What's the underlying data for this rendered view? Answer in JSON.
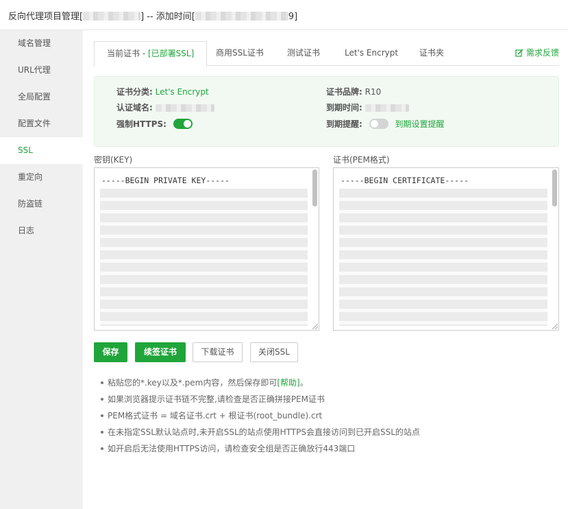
{
  "window": {
    "title_prefix": "反向代理项目管理[",
    "title_middle": "] -- 添加时间[",
    "title_suffix": "9]"
  },
  "sidebar": {
    "items": [
      {
        "label": "域名管理"
      },
      {
        "label": "URL代理"
      },
      {
        "label": "全局配置"
      },
      {
        "label": "配置文件"
      },
      {
        "label": "SSL"
      },
      {
        "label": "重定向"
      },
      {
        "label": "防盗链"
      },
      {
        "label": "日志"
      }
    ],
    "active_index": 4
  },
  "tabs": {
    "current_prefix": "当前证书 - ",
    "current_status": "[已部署SSL]",
    "commercial": "商用SSL证书",
    "test": "测试证书",
    "letsencrypt": "Let's Encrypt",
    "folder": "证书夹",
    "feedback": "需求反馈"
  },
  "cert_info": {
    "category_label": "证书分类:",
    "category_value": "Let's Encrypt",
    "domain_label": "认证域名:",
    "force_https_label": "强制HTTPS:",
    "force_https_on": true,
    "brand_label": "证书品牌:",
    "brand_value": "R10",
    "expire_label": "到期时间:",
    "remind_label": "到期提醒:",
    "remind_on": false,
    "remind_link": "到期设置提醒"
  },
  "key_panel": {
    "label": "密钥(KEY)",
    "first_line": "-----BEGIN PRIVATE KEY-----"
  },
  "cert_panel": {
    "label": "证书(PEM格式)",
    "first_line": "-----BEGIN CERTIFICATE-----"
  },
  "buttons": {
    "save": "保存",
    "renew": "续签证书",
    "download": "下载证书",
    "close_ssl": "关闭SSL"
  },
  "tips": {
    "tip1_text": "粘贴您的*.key以及*.pem内容，然后保存即可",
    "tip1_link": "[帮助]",
    "tip1_end": "。",
    "tip2": "如果浏览器提示证书链不完整,请检查是否正确拼接PEM证书",
    "tip3": "PEM格式证书 = 域名证书.crt + 根证书(root_bundle).crt",
    "tip4": "在未指定SSL默认站点时,未开启SSL的站点使用HTTPS会直接访问到已开启SSL的站点",
    "tip5": "如开启后无法使用HTTPS访问，请检查安全组是否正确放行443端口"
  },
  "colors": {
    "accent": "#20a53a",
    "info_bg": "#f2f9f3",
    "sidebar_bg": "#f0f0f0"
  }
}
